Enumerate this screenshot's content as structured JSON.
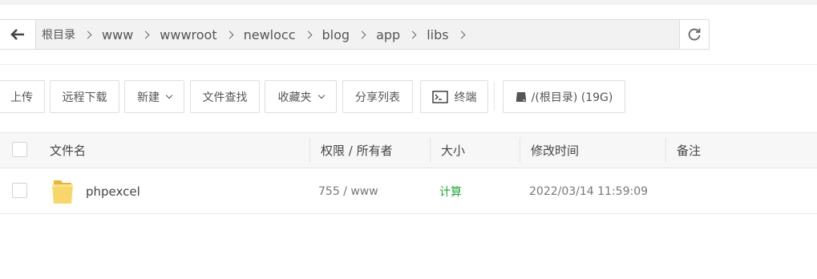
{
  "path": {
    "crumbs": [
      "根目录",
      "www",
      "wwwroot",
      "newlocc",
      "blog",
      "app",
      "libs"
    ]
  },
  "toolbar": {
    "upload": "上传",
    "remote_download": "远程下载",
    "new": "新建",
    "file_search": "文件查找",
    "favorites": "收藏夹",
    "share_list": "分享列表",
    "terminal": "终端",
    "disk": "/(根目录) (19G)"
  },
  "table": {
    "headers": {
      "name": "文件名",
      "permission": "权限 / 所有者",
      "size": "大小",
      "mtime": "修改时间",
      "note": "备注"
    },
    "rows": [
      {
        "name": "phpexcel",
        "permission": "755 / www",
        "size": "计算",
        "mtime": "2022/03/14 11:59:09",
        "note": ""
      }
    ]
  },
  "colors": {
    "folder": "#f5c542",
    "size_link": "#20a53a",
    "crumb_bg": "#f2f2f2",
    "header_bg": "#f7f7f7"
  },
  "icons": [
    "back-arrow-icon",
    "chevron-right-icon",
    "refresh-icon",
    "chevron-down-icon",
    "terminal-icon",
    "disk-icon",
    "folder-icon"
  ]
}
